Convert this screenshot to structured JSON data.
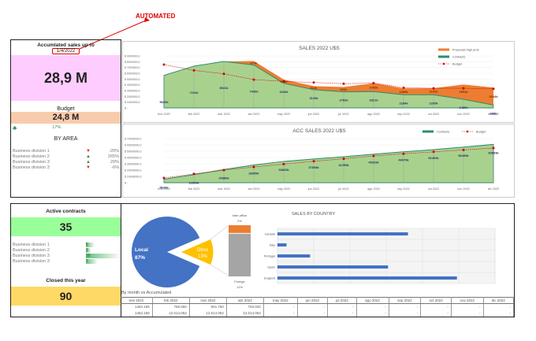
{
  "annotation": {
    "label": "AUTOMATED",
    "color": "#e00000"
  },
  "summary": {
    "title": "Accumlated sales up to",
    "date": "1/4/2022",
    "total": "28,9 M",
    "budget_label": "Budget",
    "budget_value": "24,8 M",
    "variance": "17%",
    "by_area_title": "BY AREA",
    "areas": [
      {
        "name": "Business division 1",
        "change": "-20%",
        "trend": "down"
      },
      {
        "name": "Business division 2",
        "change": "265%",
        "trend": "up"
      },
      {
        "name": "Business division 3",
        "change": "29%",
        "trend": "up"
      },
      {
        "name": "Business division 3",
        "change": "-6%",
        "trend": "down"
      }
    ]
  },
  "contracts": {
    "title": "Active contracts",
    "value": "35",
    "divisions": [
      {
        "name": "Business division 1",
        "count": 5
      },
      {
        "name": "Business division 2",
        "count": 3
      },
      {
        "name": "Business division 3",
        "count": 20
      },
      {
        "name": "Business division 3",
        "count": 7
      }
    ],
    "closed_label": "Closed this year",
    "closed_value": "90"
  },
  "colors": {
    "contracts": "#a9d18e",
    "contracts_line": "#2e8b6e",
    "proposals": "#ed7d31",
    "budget": "#d00000",
    "local": "#4472c4",
    "otros": "#ffc000",
    "foreign": "#a5a5a5",
    "bars": "#4472c4"
  },
  "chart_data": [
    {
      "type": "area",
      "title": "SALES 2022 U$S",
      "categories": [
        "ene 2022",
        "feb 2022",
        "mar 2022",
        "abr 2022",
        "may 2022",
        "jun 2022",
        "jul 2022",
        "ago 2022",
        "sep 2022",
        "oct 2022",
        "nov 2022",
        "dic 2022"
      ],
      "yticks": [
        "$ -",
        "$ 1000000,0",
        "$ 2000000,0",
        "$ 3000000,0",
        "$ 4000000,0",
        "$ 5000000,0",
        "$ 6000000,0",
        "$ 7000000,0",
        "$ 8000000,0",
        "$ 9000000,0"
      ],
      "ylim": [
        0,
        9000000
      ],
      "legend": "top-right",
      "series": [
        {
          "name": "Contracts",
          "values": [
            5620,
            7234,
            8041,
            7436,
            4249,
            3149,
            2783,
            2821,
            2284,
            2265,
            1486,
            486
          ],
          "labels": [
            "5620k",
            "7234k",
            "8041k",
            "7436k",
            "4249k",
            "3149k",
            "2783k",
            "2821k",
            "2284k",
            "2265k",
            "1486k",
            "486k"
          ]
        },
        {
          "name": "Proposals high prob",
          "values": [
            0,
            0,
            0,
            674,
            668,
            613,
            826,
            1453,
            1085,
            1152,
            2554,
            3034
          ],
          "labels": [
            "",
            "",
            "",
            "674k",
            "668k",
            "613k",
            "826k",
            "1453k",
            "1085k",
            "1152k",
            "2554k",
            "3034k"
          ]
        },
        {
          "name": "Budget",
          "values": [
            7500,
            6500,
            5900,
            4900,
            4600,
            4400,
            4200,
            4300,
            3500,
            3400,
            3400,
            3300
          ]
        }
      ],
      "unit": "thousands"
    },
    {
      "type": "area",
      "title": "ACC SALES 2022 U$S",
      "categories": [
        "ene 2022",
        "feb 2022",
        "mar 2022",
        "abr 2022",
        "may 2022",
        "jun 2022",
        "jul 2022",
        "ago 2022",
        "sep 2022",
        "oct 2022",
        "nov 2022",
        "dic 2022"
      ],
      "yticks": [
        "$ -",
        "$ 10000000,0",
        "$ 20000000,0",
        "$ 30000000,0",
        "$ 40000000,0",
        "$ 50000000,0",
        "$ 60000000,0",
        "$ 70000000,0"
      ],
      "ylim": [
        0,
        70000000
      ],
      "legend": "top-right",
      "series": [
        {
          "name": "Contracts",
          "values": [
            5620,
            12854,
            20886,
            28055,
            33825,
            37698,
            41255,
            45329,
            49079,
            52454,
            56495,
            60853
          ],
          "labels": [
            "5620k",
            "12854k",
            "20886k",
            "28055k",
            "33825k",
            "37698k",
            "41255k",
            "45329k",
            "49079k",
            "52454k",
            "56495k",
            "60853k"
          ]
        },
        {
          "name": "Budget",
          "values": [
            7500,
            14000,
            20000,
            25000,
            29500,
            34000,
            38000,
            42500,
            46000,
            49000,
            52000,
            55000
          ]
        }
      ],
      "unit": "thousands"
    },
    {
      "type": "pie",
      "slices": [
        {
          "label": "Local",
          "pct": "87%",
          "value": 87
        },
        {
          "label": "Otros",
          "pct": "13%",
          "value": 13
        }
      ],
      "breakdown": [
        {
          "label": "Inter-office",
          "pct": "2%",
          "value": 2
        },
        {
          "label": "Foreign",
          "pct": "11%",
          "value": 11
        }
      ]
    },
    {
      "type": "bar",
      "title": "SALES BY COUNTRY",
      "categories": [
        "Canada",
        "Italy",
        "Portugal",
        "Spain",
        "England"
      ],
      "values": [
        3.6,
        0.25,
        0.9,
        3.05,
        4.95
      ],
      "xlim": [
        0,
        6
      ],
      "grid": true
    }
  ],
  "table": {
    "title": "By month vs Accumulated",
    "headers": [
      "ene 2022",
      "feb 2022",
      "mar 2022",
      "abr 2022",
      "may 2022",
      "jun 2022",
      "jul 2022",
      "ago 2022",
      "sep 2022",
      "oct 2022",
      "nov 2022",
      "dic 2022"
    ],
    "rows": [
      [
        "1462.165",
        "759.050",
        "841.750",
        "753.032",
        "-",
        "-",
        "-",
        "-",
        "-",
        "-",
        "-",
        "-"
      ],
      [
        "1462.165",
        "12.014.052",
        "12.014.052",
        "12.014.052",
        "-",
        "-",
        "-",
        "-",
        "-",
        "-",
        "-",
        "-"
      ]
    ]
  }
}
